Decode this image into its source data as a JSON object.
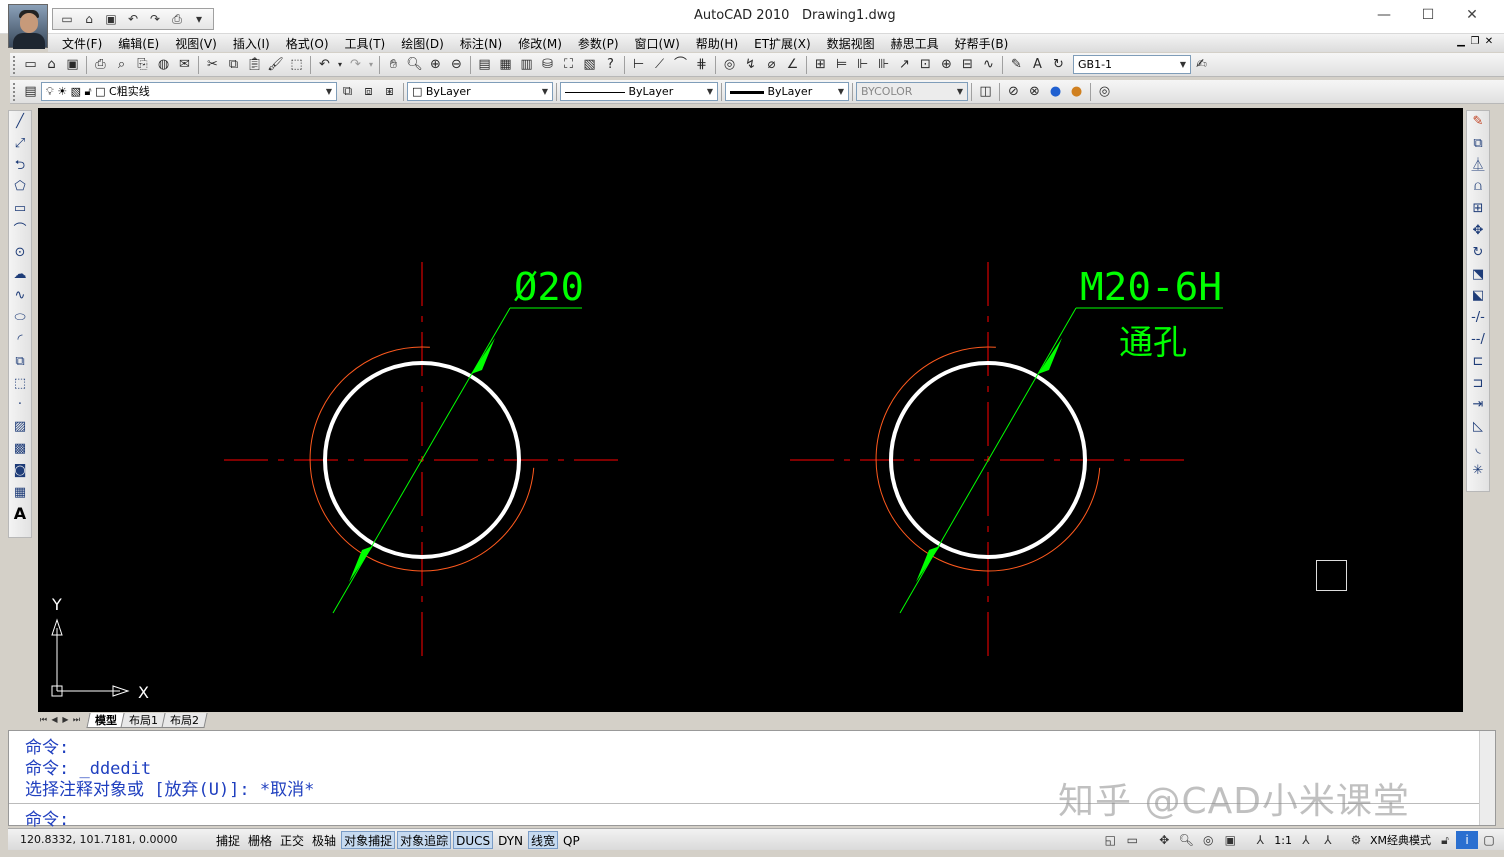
{
  "title_bar": {
    "app_name": "AutoCAD 2010",
    "document": "Drawing1.dwg",
    "minimize": "—",
    "maximize": "☐",
    "close": "✕"
  },
  "menu": [
    "文件(F)",
    "编辑(E)",
    "视图(V)",
    "插入(I)",
    "格式(O)",
    "工具(T)",
    "绘图(D)",
    "标注(N)",
    "修改(M)",
    "参数(P)",
    "窗口(W)",
    "帮助(H)",
    "ET扩展(X)",
    "数据视图",
    "赫思工具",
    "好帮手(B)"
  ],
  "toolbar": {
    "dimstyle": "GB1-1",
    "layer": "C粗实线",
    "color": "ByLayer",
    "linetype": "ByLayer",
    "lineweight": "ByLayer",
    "plotstyle": "BYCOLOR"
  },
  "drawing": {
    "dim_left": "Ø20",
    "dim_right_line1": "M20-6H",
    "dim_right_line2": "通孔",
    "ucs_x": "X",
    "ucs_y": "Y"
  },
  "layout_tabs": [
    "模型",
    "布局1",
    "布局2"
  ],
  "command": {
    "line1": "命令:",
    "line2": "命令: _ddedit",
    "line3": "选择注释对象或 [放弃(U)]: *取消*",
    "prompt": "命令:"
  },
  "watermark": "知乎 @CAD小米课堂",
  "status": {
    "coordinates": "120.8332, 101.7181, 0.0000",
    "toggles": [
      {
        "label": "捕捉",
        "on": false
      },
      {
        "label": "栅格",
        "on": false
      },
      {
        "label": "正交",
        "on": false
      },
      {
        "label": "极轴",
        "on": false
      },
      {
        "label": "对象捕捉",
        "on": true
      },
      {
        "label": "对象追踪",
        "on": true
      },
      {
        "label": "DUCS",
        "on": true
      },
      {
        "label": "DYN",
        "on": false
      },
      {
        "label": "线宽",
        "on": true
      },
      {
        "label": "QP",
        "on": false
      }
    ],
    "annotation_scale": "1:1",
    "workspace": "XM经典模式"
  },
  "colors": {
    "canvas": "#000000",
    "centerline": "#ff0000",
    "dimension": "#00ff00",
    "object": "#ffffff",
    "thread": "#ff5a1e",
    "command_text": "#1f3fbf"
  }
}
